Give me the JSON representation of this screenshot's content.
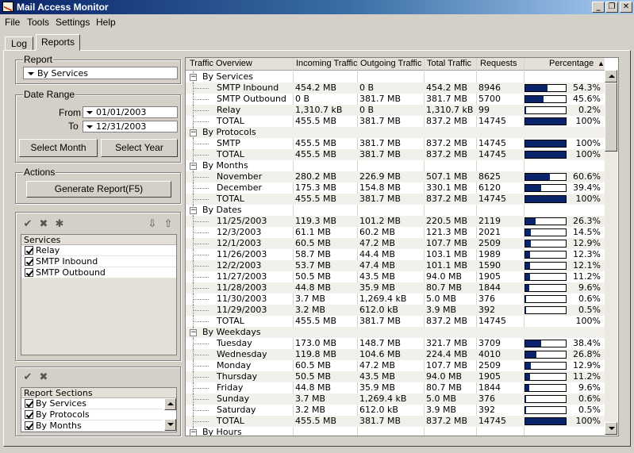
{
  "window": {
    "title": "Mail Access Monitor",
    "minimize_label": "_",
    "restore_label": "❐",
    "close_label": "✕"
  },
  "menu": [
    "File",
    "Tools",
    "Settings",
    "Help"
  ],
  "tabs": [
    {
      "label": "Log",
      "active": false
    },
    {
      "label": "Reports",
      "active": true
    }
  ],
  "report": {
    "group_label": "Report",
    "selected": "By Services"
  },
  "date_range": {
    "group_label": "Date Range",
    "from_label": "From",
    "from_value": "01/01/2003",
    "to_label": "To",
    "to_value": "12/31/2003",
    "select_month_label": "Select Month",
    "select_year_label": "Select Year"
  },
  "actions": {
    "group_label": "Actions",
    "generate_label": "Generate Report(F5)"
  },
  "services_list": {
    "header": "Services",
    "items": [
      "Relay",
      "SMTP Inbound",
      "SMTP Outbound"
    ]
  },
  "sections_list": {
    "header": "Report Sections",
    "items": [
      "By Services",
      "By Protocols",
      "By Months"
    ]
  },
  "table": {
    "columns": [
      "Traffic Overview",
      "Incoming Traffic",
      "Outgoing Traffic",
      "Total Traffic",
      "Requests",
      "Percentage"
    ],
    "sort_indicator": "▲",
    "rows": [
      {
        "kind": "group",
        "label": "By Services"
      },
      {
        "kind": "item",
        "label": "SMTP Inbound",
        "incoming": "454.2 MB",
        "outgoing": "0 B",
        "total": "454.2 MB",
        "requests": "8946",
        "pct": 54.3,
        "pct_text": "54.3%"
      },
      {
        "kind": "item",
        "label": "SMTP Outbound",
        "incoming": "0 B",
        "outgoing": "381.7 MB",
        "total": "381.7 MB",
        "requests": "5700",
        "pct": 45.6,
        "pct_text": "45.6%"
      },
      {
        "kind": "item",
        "label": "Relay",
        "incoming": "1,310.7 kB",
        "outgoing": "0 B",
        "total": "1,310.7 kB",
        "requests": "99",
        "pct": 0.2,
        "pct_text": "0.2%"
      },
      {
        "kind": "item",
        "label": "TOTAL",
        "incoming": "455.5 MB",
        "outgoing": "381.7 MB",
        "total": "837.2 MB",
        "requests": "14745",
        "pct": 100,
        "pct_text": "100%"
      },
      {
        "kind": "group",
        "label": "By Protocols"
      },
      {
        "kind": "item",
        "label": "SMTP",
        "incoming": "455.5 MB",
        "outgoing": "381.7 MB",
        "total": "837.2 MB",
        "requests": "14745",
        "pct": 100,
        "pct_text": "100%"
      },
      {
        "kind": "item",
        "label": "TOTAL",
        "incoming": "455.5 MB",
        "outgoing": "381.7 MB",
        "total": "837.2 MB",
        "requests": "14745",
        "pct": 100,
        "pct_text": "100%"
      },
      {
        "kind": "group",
        "label": "By Months"
      },
      {
        "kind": "item",
        "label": "November",
        "incoming": "280.2 MB",
        "outgoing": "226.9 MB",
        "total": "507.1 MB",
        "requests": "8625",
        "pct": 60.6,
        "pct_text": "60.6%"
      },
      {
        "kind": "item",
        "label": "December",
        "incoming": "175.3 MB",
        "outgoing": "154.8 MB",
        "total": "330.1 MB",
        "requests": "6120",
        "pct": 39.4,
        "pct_text": "39.4%"
      },
      {
        "kind": "item",
        "label": "TOTAL",
        "incoming": "455.5 MB",
        "outgoing": "381.7 MB",
        "total": "837.2 MB",
        "requests": "14745",
        "pct": 100,
        "pct_text": "100%"
      },
      {
        "kind": "group",
        "label": "By Dates"
      },
      {
        "kind": "item",
        "label": "11/25/2003",
        "incoming": "119.3 MB",
        "outgoing": "101.2 MB",
        "total": "220.5 MB",
        "requests": "2119",
        "pct": 26.3,
        "pct_text": "26.3%"
      },
      {
        "kind": "item",
        "label": "12/3/2003",
        "incoming": "61.1 MB",
        "outgoing": "60.2 MB",
        "total": "121.3 MB",
        "requests": "2021",
        "pct": 14.5,
        "pct_text": "14.5%"
      },
      {
        "kind": "item",
        "label": "12/1/2003",
        "incoming": "60.5 MB",
        "outgoing": "47.2 MB",
        "total": "107.7 MB",
        "requests": "2509",
        "pct": 12.9,
        "pct_text": "12.9%"
      },
      {
        "kind": "item",
        "label": "11/26/2003",
        "incoming": "58.7 MB",
        "outgoing": "44.4 MB",
        "total": "103.1 MB",
        "requests": "1989",
        "pct": 12.3,
        "pct_text": "12.3%"
      },
      {
        "kind": "item",
        "label": "12/2/2003",
        "incoming": "53.7 MB",
        "outgoing": "47.4 MB",
        "total": "101.1 MB",
        "requests": "1590",
        "pct": 12.1,
        "pct_text": "12.1%"
      },
      {
        "kind": "item",
        "label": "11/27/2003",
        "incoming": "50.5 MB",
        "outgoing": "43.5 MB",
        "total": "94.0 MB",
        "requests": "1905",
        "pct": 11.2,
        "pct_text": "11.2%"
      },
      {
        "kind": "item",
        "label": "11/28/2003",
        "incoming": "44.8 MB",
        "outgoing": "35.9 MB",
        "total": "80.7 MB",
        "requests": "1844",
        "pct": 9.6,
        "pct_text": "9.6%"
      },
      {
        "kind": "item",
        "label": "11/30/2003",
        "incoming": "3.7 MB",
        "outgoing": "1,269.4 kB",
        "total": "5.0 MB",
        "requests": "376",
        "pct": 0.6,
        "pct_text": "0.6%"
      },
      {
        "kind": "item",
        "label": "11/29/2003",
        "incoming": "3.2 MB",
        "outgoing": "612.0 kB",
        "total": "3.9 MB",
        "requests": "392",
        "pct": 0.5,
        "pct_text": "0.5%"
      },
      {
        "kind": "item",
        "label": "TOTAL",
        "incoming": "455.5 MB",
        "outgoing": "381.7 MB",
        "total": "837.2 MB",
        "requests": "14745",
        "pct": null,
        "pct_text": "100%"
      },
      {
        "kind": "group",
        "label": "By Weekdays"
      },
      {
        "kind": "item",
        "label": "Tuesday",
        "incoming": "173.0 MB",
        "outgoing": "148.7 MB",
        "total": "321.7 MB",
        "requests": "3709",
        "pct": 38.4,
        "pct_text": "38.4%"
      },
      {
        "kind": "item",
        "label": "Wednesday",
        "incoming": "119.8 MB",
        "outgoing": "104.6 MB",
        "total": "224.4 MB",
        "requests": "4010",
        "pct": 26.8,
        "pct_text": "26.8%"
      },
      {
        "kind": "item",
        "label": "Monday",
        "incoming": "60.5 MB",
        "outgoing": "47.2 MB",
        "total": "107.7 MB",
        "requests": "2509",
        "pct": 12.9,
        "pct_text": "12.9%"
      },
      {
        "kind": "item",
        "label": "Thursday",
        "incoming": "50.5 MB",
        "outgoing": "43.5 MB",
        "total": "94.0 MB",
        "requests": "1905",
        "pct": 11.2,
        "pct_text": "11.2%"
      },
      {
        "kind": "item",
        "label": "Friday",
        "incoming": "44.8 MB",
        "outgoing": "35.9 MB",
        "total": "80.7 MB",
        "requests": "1844",
        "pct": 9.6,
        "pct_text": "9.6%"
      },
      {
        "kind": "item",
        "label": "Sunday",
        "incoming": "3.7 MB",
        "outgoing": "1,269.4 kB",
        "total": "5.0 MB",
        "requests": "376",
        "pct": 0.6,
        "pct_text": "0.6%"
      },
      {
        "kind": "item",
        "label": "Saturday",
        "incoming": "3.2 MB",
        "outgoing": "612.0 kB",
        "total": "3.9 MB",
        "requests": "392",
        "pct": 0.5,
        "pct_text": "0.5%"
      },
      {
        "kind": "item",
        "label": "TOTAL",
        "incoming": "455.5 MB",
        "outgoing": "381.7 MB",
        "total": "837.2 MB",
        "requests": "14745",
        "pct": 100,
        "pct_text": "100%"
      },
      {
        "kind": "group",
        "label": "By Hours"
      }
    ]
  },
  "icons": {
    "check": "check-icon",
    "uncheck": "uncheck-icon",
    "invert": "invert-icon",
    "move_down": "move-down-icon",
    "move_up": "move-up-icon"
  },
  "colors": {
    "title_start": "#0a246a",
    "title_end": "#a6caf0",
    "bar_fill": "#0a246a",
    "face": "#d4d0c8"
  }
}
